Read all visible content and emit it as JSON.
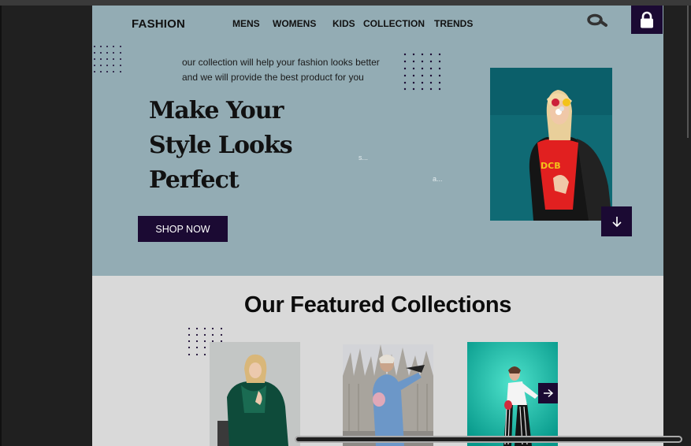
{
  "header": {
    "brand": "FASHION",
    "nav": [
      "MENS",
      "WOMENS",
      "KIDS",
      "COLLECTION",
      "TRENDS"
    ]
  },
  "icons": {
    "search": "search-icon",
    "lock": "lock-icon",
    "down": "arrow-down-icon",
    "next": "arrow-right-icon"
  },
  "hero": {
    "tagline_line1": "our collection will help your fashion looks better",
    "tagline_line2": "and we will provide the best product for you",
    "headline_line1": "Make Your",
    "headline_line2": "Style Looks",
    "headline_line3": "Perfect",
    "cta_label": "SHOP NOW",
    "faint_1": "s...",
    "faint_2": "a..."
  },
  "featured": {
    "title": "Our Featured Collections"
  },
  "colors": {
    "hero_bg": "#93acb4",
    "section_bg": "#d9d9d9",
    "accent_dark": "#1b0a33",
    "teal_photo": "#0d6f78"
  }
}
